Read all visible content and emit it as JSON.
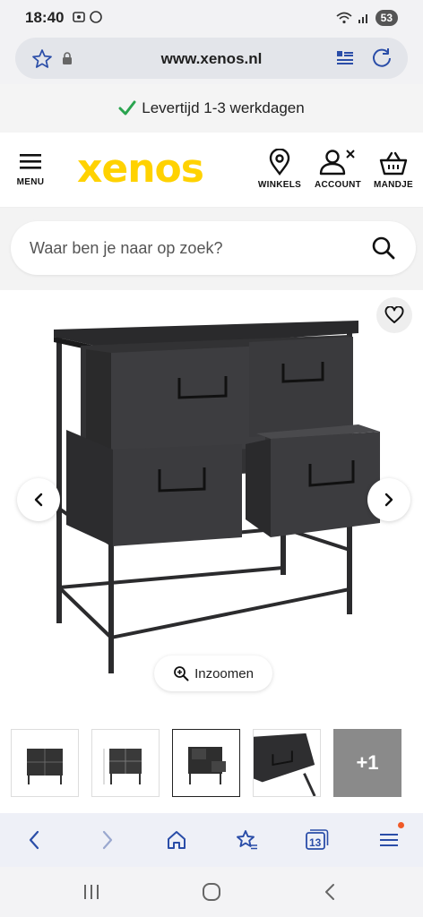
{
  "status": {
    "time": "18:40",
    "battery": "53"
  },
  "browser": {
    "url": "www.xenos.nl",
    "tab_count": "13"
  },
  "banner": {
    "text": "Levertijd 1-3 werkdagen"
  },
  "header": {
    "logo": "xenos",
    "menu_label": "MENU",
    "stores_label": "WINKELS",
    "account_label": "ACCOUNT",
    "cart_label": "MANDJE"
  },
  "search": {
    "placeholder": "Waar ben je naar op zoek?"
  },
  "gallery": {
    "zoom_label": "Inzoomen"
  },
  "thumbnails": {
    "more_label": "+1"
  },
  "colors": {
    "brand": "#ffd200",
    "accent": "#2a4da8",
    "check": "#2aa44f"
  }
}
